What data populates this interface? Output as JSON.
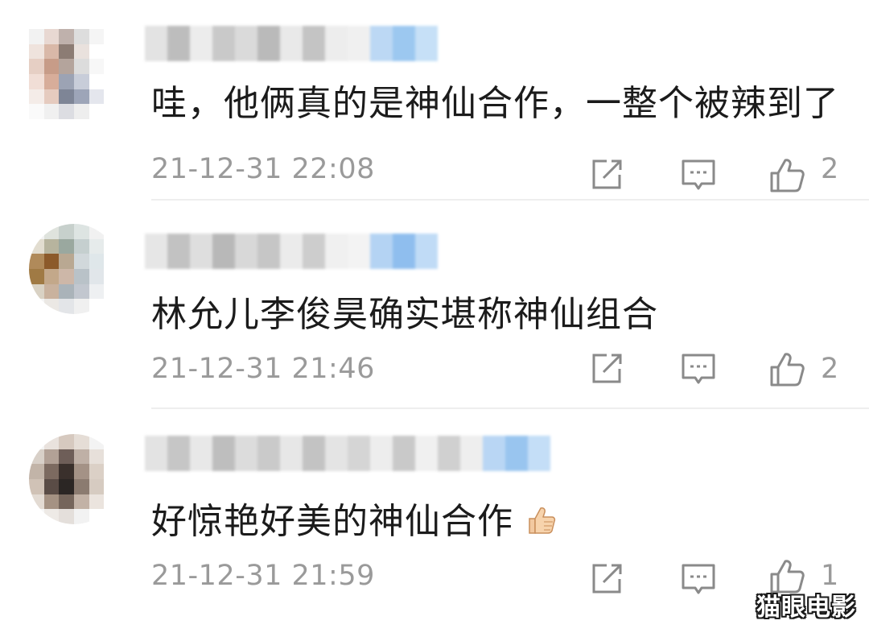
{
  "comments": [
    {
      "text": "哇，他俩真的是神仙合作，一整个被辣到了",
      "time": "21-12-31 22:08",
      "likes": "2",
      "avatar_tiles": [
        "#f2f2f2",
        "#e8d8d2",
        "#bfb1ac",
        "#ddd",
        "#f5f5f5",
        "#fff",
        "#efe3dd",
        "#d9b8a8",
        "#8c7c74",
        "#e9e1dd",
        "#fff",
        "#fff",
        "#e6cfc4",
        "#c79c88",
        "#b4a49c",
        "#dcdcdc",
        "#f7f7f7",
        "#fff",
        "#f1ded6",
        "#d7ad9a",
        "#9ca3b4",
        "#c8cdd9",
        "#ffffff",
        "#fff",
        "#f4ece8",
        "#e5cbbf",
        "#7e8596",
        "#9da5b8",
        "#e4e6ed",
        "#fff",
        "#fafafa",
        "#f0f0f0",
        "#dcdde2",
        "#eeeeee",
        "#ffffff",
        "#fff"
      ],
      "name_tiles": [
        "#e3e3e3",
        "#bdbdbd",
        "#ececec",
        "#c9c9c9",
        "#dadada",
        "#bababa",
        "#e9e9e9",
        "#c4c4c4",
        "#ededed",
        "#f0f0f0",
        "#bcd8f4",
        "#9cc8f0",
        "#c6e0f7"
      ]
    },
    {
      "text": "林允儿李俊昊确实堪称神仙组合",
      "time": "21-12-31 21:46",
      "likes": "2",
      "avatar_tiles": [
        "#f3f3f3",
        "#dfe3dd",
        "#c7d0cc",
        "#dde4e2",
        "#f1f1f1",
        "#fff",
        "#e2ddd0",
        "#b7b49e",
        "#9aa89f",
        "#c5cfcf",
        "#e6ebeb",
        "#fff",
        "#b08a5a",
        "#8c5a2a",
        "#b9a892",
        "#d1d8db",
        "#dfe7ea",
        "#fff",
        "#a07a44",
        "#c3a88a",
        "#cdb7a8",
        "#b9c2c8",
        "#e1e6ea",
        "#fff",
        "#d9d2c4",
        "#c9b29e",
        "#aab3b9",
        "#c2c7cf",
        "#eef0f2",
        "#fff",
        "#f5f5f5",
        "#ebe8e4",
        "#e3e5e8",
        "#f0f0f0",
        "#ffffff",
        "#fff"
      ],
      "name_tiles": [
        "#e6e6e6",
        "#c2c2c2",
        "#dedede",
        "#b8b8b8",
        "#d8d8d8",
        "#c6c6c6",
        "#ebebeb",
        "#cdcdcd",
        "#f0f0f0",
        "#f3f3f3",
        "#b4d3f3",
        "#8fbeee",
        "#c0dbf6"
      ]
    },
    {
      "text": "好惊艳好美的神仙合作",
      "time": "21-12-31 21:59",
      "likes": "1",
      "avatar_tiles": [
        "#f4f4f4",
        "#e9e2dd",
        "#d6c9bf",
        "#e5ddd6",
        "#f3f3f3",
        "#fff",
        "#d8d0c8",
        "#b2a196",
        "#6e5e58",
        "#bfb0a6",
        "#e7e0da",
        "#fff",
        "#c2b4a8",
        "#7c6a60",
        "#3a302c",
        "#a49286",
        "#dbd0c6",
        "#fff",
        "#d0c2b6",
        "#5a4c46",
        "#2b2624",
        "#8b7b70",
        "#d6cbc1",
        "#fff",
        "#e3dbd3",
        "#a59283",
        "#75655b",
        "#c2b2a6",
        "#ebe4de",
        "#fff",
        "#f7f7f7",
        "#eeeae6",
        "#e4dfdb",
        "#f2f2f2",
        "#ffffff",
        "#fff"
      ],
      "name_tiles": [
        "#e3e3e3",
        "#c6c6c6",
        "#e8e8e8",
        "#bebebe",
        "#dcdcdc",
        "#cacaca",
        "#e7e7e7",
        "#c3c3c3",
        "#e4e4e4",
        "#d5d5d5",
        "#ededed",
        "#c9c9c9",
        "#f0f0f0",
        "#d0d0d0",
        "#eeeeee",
        "#b9d6f4",
        "#99c5ef",
        "#c4def7"
      ]
    }
  ],
  "watermark": "猫眼电影",
  "icons": {
    "share": "share-icon",
    "reply": "comment-icon",
    "like": "thumbs-up-icon",
    "emoji": "thumbs-up-emoji"
  },
  "colors": {
    "text": "#1b1b1b",
    "meta": "#9a9a9a",
    "icon": "#8a8a8a",
    "divider": "#eeeeee"
  }
}
